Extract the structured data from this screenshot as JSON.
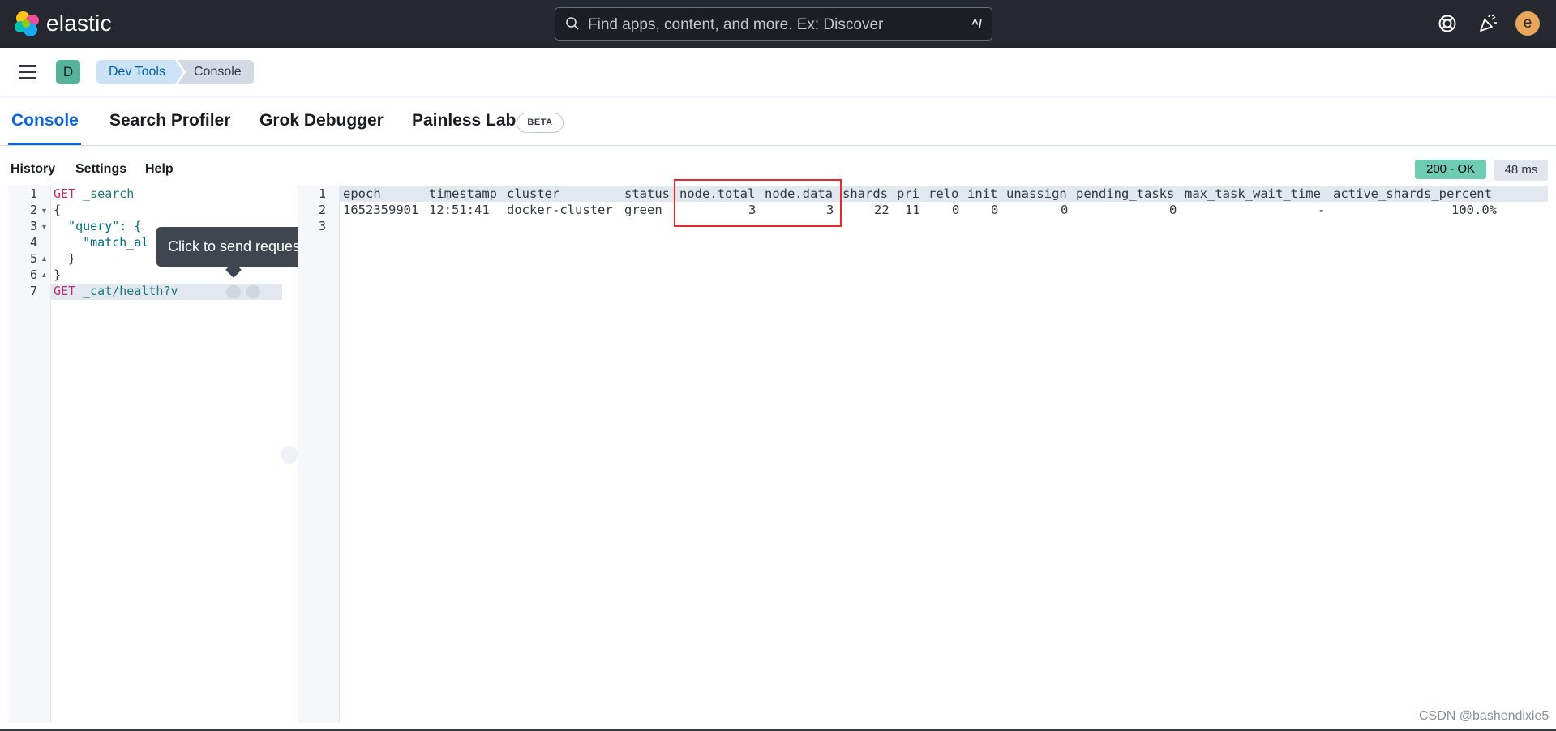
{
  "header": {
    "logo_text": "elastic",
    "search_placeholder": "Find apps, content, and more. Ex: Discover",
    "search_shortcut": "^/",
    "avatar_initial": "e"
  },
  "navbar": {
    "space_initial": "D",
    "breadcrumbs": [
      "Dev Tools",
      "Console"
    ]
  },
  "tabs": {
    "items": [
      "Console",
      "Search Profiler",
      "Grok Debugger",
      "Painless Lab"
    ],
    "active": "Console",
    "beta_badge": "BETA"
  },
  "toolbar": {
    "history": "History",
    "settings": "Settings",
    "help": "Help"
  },
  "response_status": {
    "status": "200 - OK",
    "time": "48 ms"
  },
  "request_editor": {
    "line_numbers": [
      "1",
      "2",
      "3",
      "4",
      "5",
      "6",
      "7"
    ],
    "lines": [
      {
        "method": "GET",
        "path": "_search"
      },
      {
        "text": "{"
      },
      {
        "text": "  \"query\": {"
      },
      {
        "text": "    \"match_al"
      },
      {
        "text": "  }"
      },
      {
        "text": "}"
      },
      {
        "method": "GET",
        "path": "_cat/health?v"
      }
    ],
    "tooltip": "Click to send request"
  },
  "response_editor": {
    "line_numbers": [
      "1",
      "2",
      "3"
    ],
    "columns": [
      "epoch",
      "timestamp",
      "cluster",
      "status",
      "node.total",
      "node.data",
      "shards",
      "pri",
      "relo",
      "init",
      "unassign",
      "pending_tasks",
      "max_task_wait_time",
      "active_shards_percent"
    ],
    "row": [
      "1652359901",
      "12:51:41",
      "docker-cluster",
      "green",
      "3",
      "3",
      "22",
      "11",
      "0",
      "0",
      "0",
      "0",
      "-",
      "100.0%"
    ]
  },
  "colors": {
    "header_bg": "#25282f",
    "accent": "#0b64dd",
    "status_ok": "#6dccb1",
    "highlight": "#e32b2b"
  },
  "watermark": "CSDN @bashendixie5"
}
